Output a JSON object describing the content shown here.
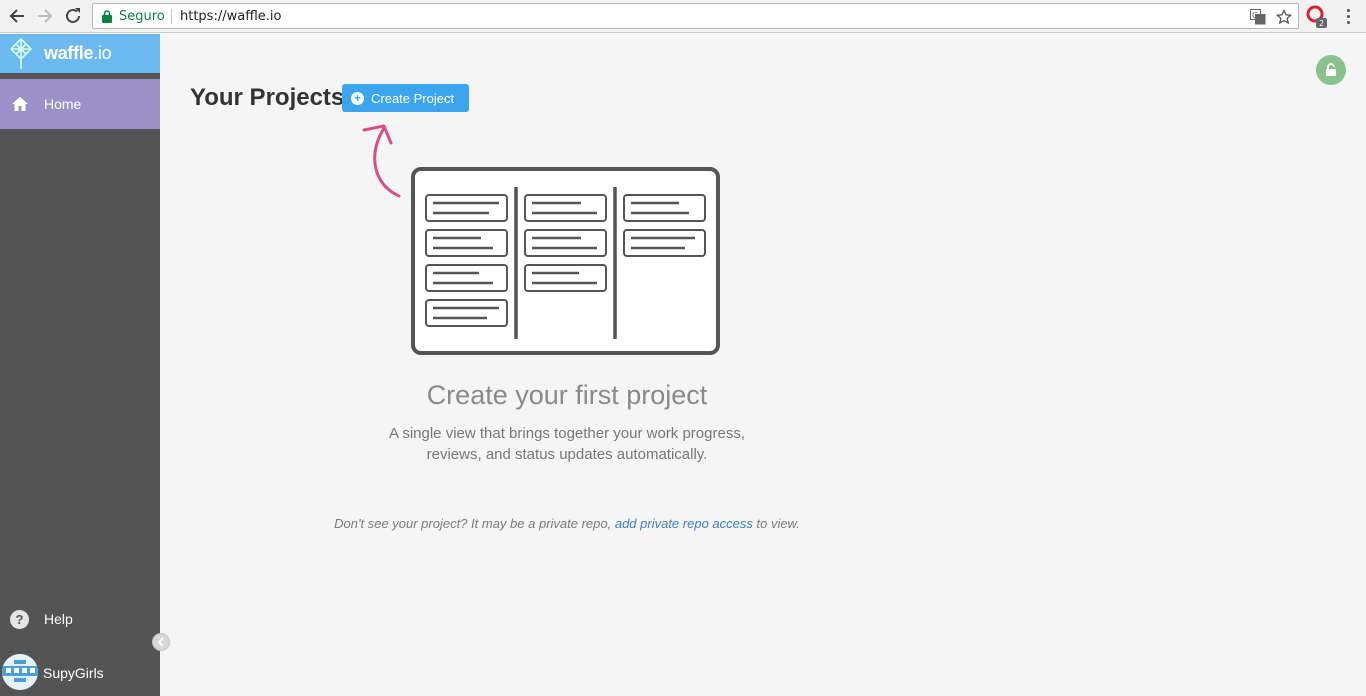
{
  "browser": {
    "secure_label": "Seguro",
    "url": "https://waffle.io",
    "extension_badge": "2"
  },
  "sidebar": {
    "brand_name": "waffle",
    "brand_suffix": ".io",
    "home_label": "Home",
    "help_label": "Help",
    "user_label": "SupyGirls"
  },
  "main": {
    "title": "Your Projects",
    "create_button_label": "Create Project",
    "empty_title": "Create your first project",
    "empty_desc_line1": "A single view that brings together your work progress,",
    "empty_desc_line2": "reviews, and status updates automatically.",
    "footnote_prefix": "Don't see your project? It may be a private repo, ",
    "footnote_link": "add private repo access",
    "footnote_suffix": " to view."
  },
  "colors": {
    "brand_bar": "#6cb9ef",
    "sidebar_bg": "#545454",
    "home_active": "#9b90c8",
    "primary_button": "#3da4ef",
    "lock_badge": "#8ac28e",
    "arrow": "#d64f86",
    "link": "#3a7fc1"
  },
  "icons": [
    "back-icon",
    "forward-icon",
    "reload-icon",
    "lock-icon",
    "translate-icon",
    "star-icon",
    "opera-extension-icon",
    "menu-icon",
    "waffle-logo",
    "home-icon",
    "help-icon",
    "collapse-icon",
    "avatar",
    "unlock-icon",
    "plus-icon"
  ]
}
